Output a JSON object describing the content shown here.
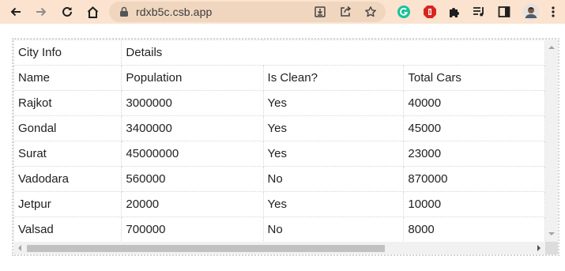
{
  "browser": {
    "url": "rdxb5c.csb.app",
    "colors": {
      "toolbar_bg": "#fbe3cf",
      "omnibox_bg": "#f0d6bf"
    },
    "icons": {
      "back": "back-arrow-icon",
      "forward": "forward-arrow-icon",
      "reload": "reload-icon",
      "home": "home-icon",
      "site_info": "site-info-icon",
      "install": "install-app-icon",
      "share": "share-icon",
      "bookmark": "bookmark-star-icon",
      "ext_grammarly": "grammarly-extension-icon",
      "ext_adblock": "adblock-extension-icon",
      "extensions": "extensions-puzzle-icon",
      "media": "media-control-icon",
      "side_panel": "side-panel-icon",
      "profile": "profile-avatar"
    }
  },
  "table": {
    "group_row": [
      "City Info",
      "Details"
    ],
    "headers": [
      "Name",
      "Population",
      "Is Clean?",
      "Total Cars"
    ],
    "rows": [
      [
        "Rajkot",
        "3000000",
        "Yes",
        "40000"
      ],
      [
        "Gondal",
        "3400000",
        "Yes",
        "45000"
      ],
      [
        "Surat",
        "45000000",
        "Yes",
        "23000"
      ],
      [
        "Vadodara",
        "560000",
        "No",
        "870000"
      ],
      [
        "Jetpur",
        "20000",
        "Yes",
        "10000"
      ],
      [
        "Valsad",
        "700000",
        "No",
        "8000"
      ]
    ]
  },
  "scrollbar": {
    "horizontal_thumb_visible_fraction": 0.67
  }
}
